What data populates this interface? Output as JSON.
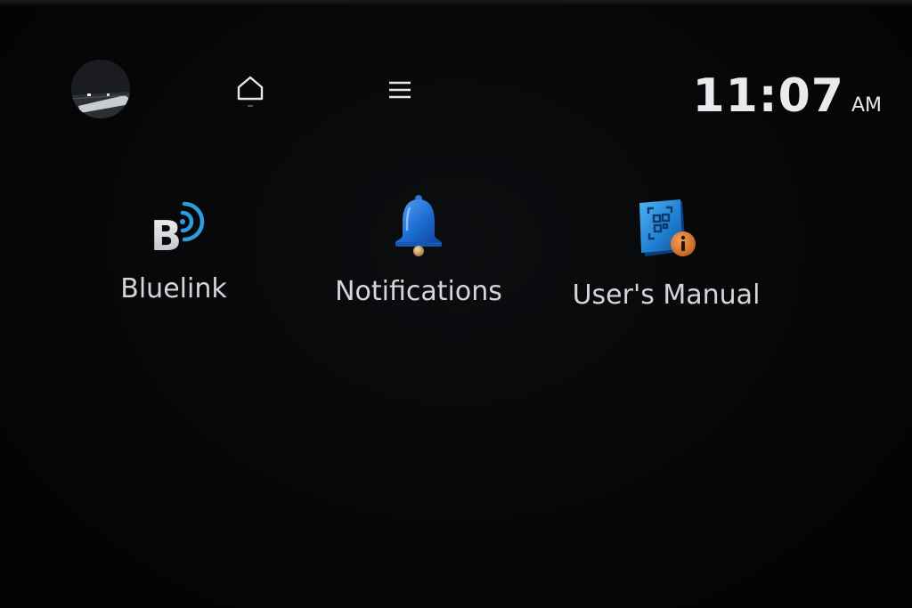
{
  "status_bar": {
    "avatar_icon": "profile-photo-icon",
    "home_icon": "home-icon",
    "menu_icon": "menu-icon",
    "clock": {
      "time": "11:07",
      "ampm": "AM"
    }
  },
  "apps": [
    {
      "label": "Bluelink",
      "icon": "bluelink-icon",
      "accent": "#2d9cdb"
    },
    {
      "label": "Notifications",
      "icon": "bell-icon",
      "accent": "#1f6fd6"
    },
    {
      "label": "User's Manual",
      "icon": "users-manual-icon",
      "accent": "#1e7fd0",
      "badge_color": "#e07a2e"
    }
  ],
  "colors": {
    "background": "#050506",
    "text": "#d9dbdf"
  }
}
